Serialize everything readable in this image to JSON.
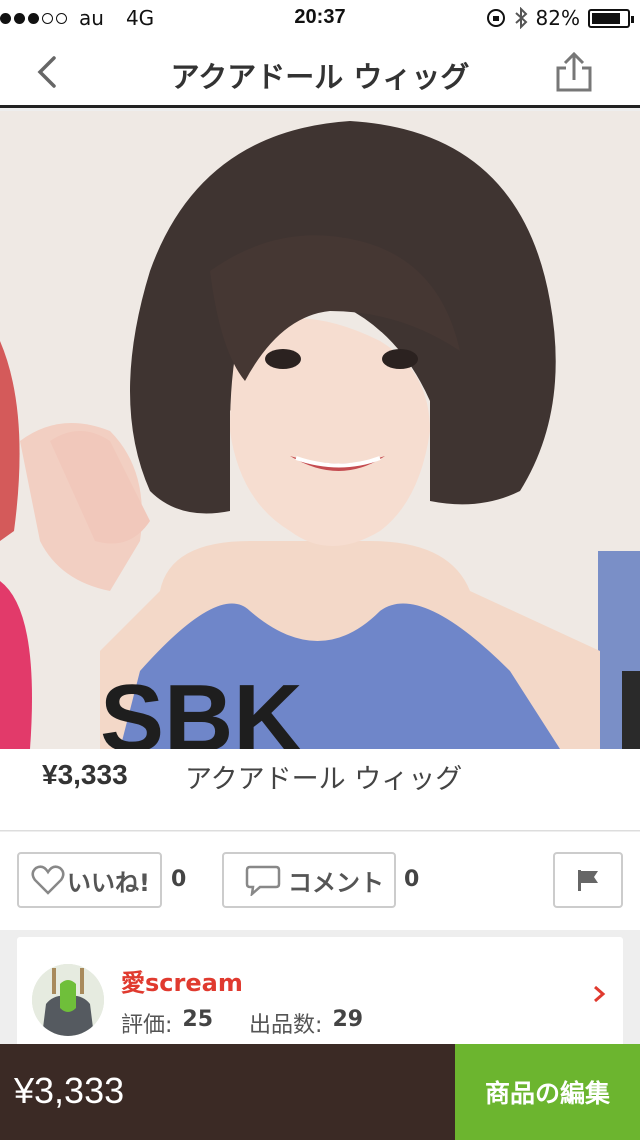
{
  "status_bar": {
    "carrier": "au",
    "network": "4G",
    "time": "20:37",
    "battery": "82%",
    "battery_level": 0.82,
    "icons": [
      "signal-dots-icon",
      "rotation-lock-icon",
      "bluetooth-icon",
      "battery-icon"
    ]
  },
  "nav": {
    "title": "アクアドール ウィッグ",
    "icons": [
      "back-chevron-icon",
      "share-icon"
    ]
  },
  "product_image": {
    "overlay_text": "SBK"
  },
  "product": {
    "price": "¥3,333",
    "name": "アクアドール ウィッグ"
  },
  "actions": {
    "like_label": "いいね!",
    "like_count": "0",
    "comment_label": "コメント",
    "comment_count": "0",
    "icons": [
      "heart-icon",
      "speech-bubble-icon",
      "flag-icon"
    ]
  },
  "seller": {
    "name": "愛scream",
    "rating_label": "評価:",
    "rating_value": "25",
    "listings_label": "出品数:",
    "listings_value": "29"
  },
  "bottom_bar": {
    "price": "¥3,333",
    "edit_button": "商品の編集"
  },
  "colors": {
    "accent_green": "#6cb52f",
    "bottom_bar_brown": "#3b2a25",
    "seller_name_red": "#e03a2f"
  }
}
